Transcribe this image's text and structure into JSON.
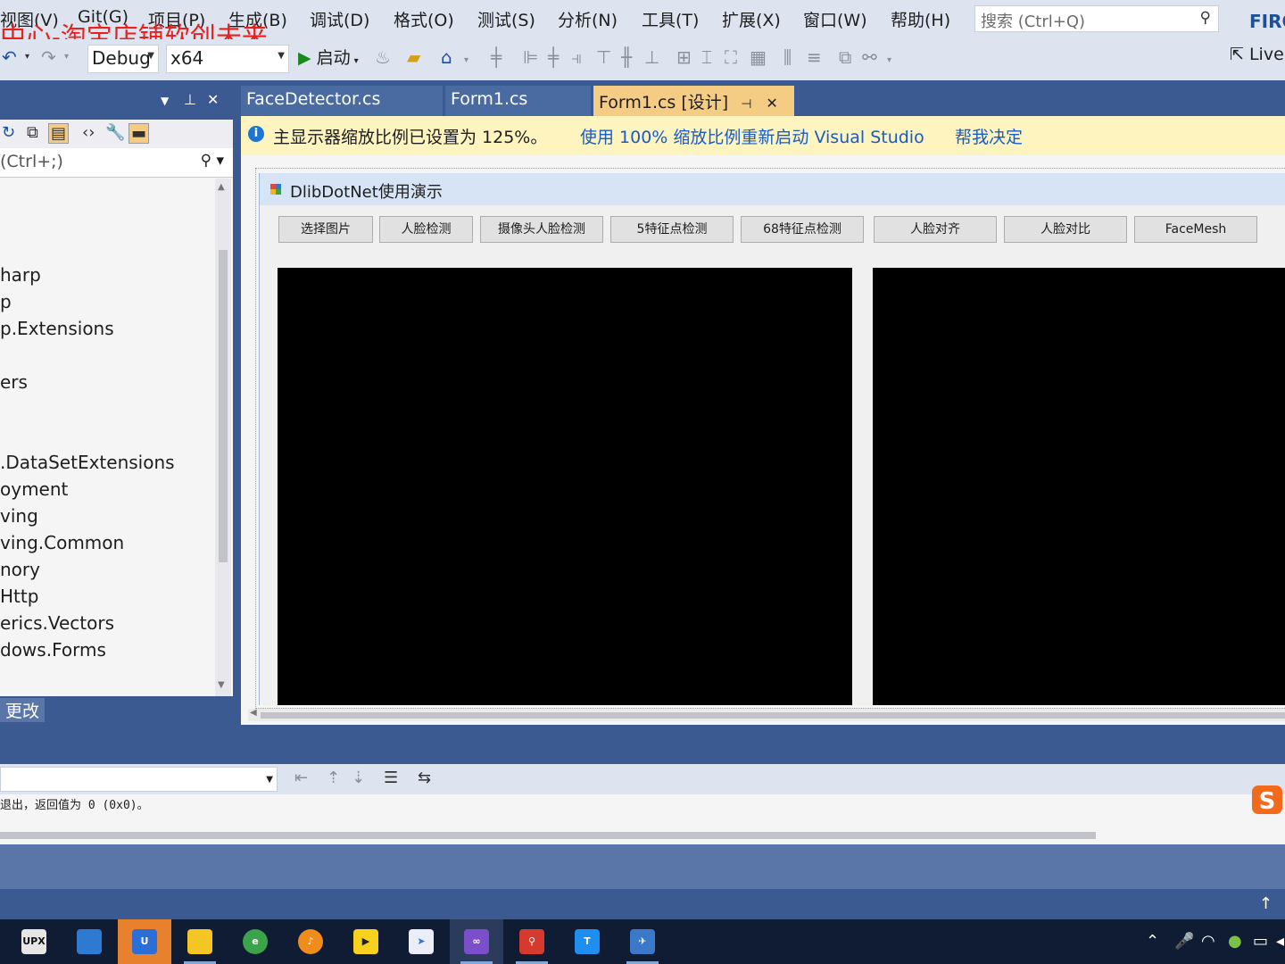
{
  "menu": {
    "items": [
      "视图(V)",
      "Git(G)",
      "项目(P)",
      "生成(B)",
      "调试(D)",
      "格式(O)",
      "测试(S)",
      "分析(N)",
      "工具(T)",
      "扩展(X)",
      "窗口(W)",
      "帮助(H)"
    ],
    "search_placeholder": "搜索 (Ctrl+Q)",
    "account_label": "FIRC"
  },
  "watermark": "中心-淘宝店铺软创未来",
  "toolbar": {
    "config": "Debug",
    "platform": "x64",
    "start_label": "启动",
    "live_share_label": "Live"
  },
  "solution_explorer": {
    "search_placeholder": "(Ctrl+;)",
    "tree_items": [
      "harp",
      "p",
      "p.Extensions",
      "ers",
      ".DataSetExtensions",
      "oyment",
      "ving",
      "ving.Common",
      "nory",
      "Http",
      "erics.Vectors",
      "dows.Forms"
    ],
    "changes_label": "更改"
  },
  "tabs": [
    {
      "label": "FaceDetector.cs"
    },
    {
      "label": "Form1.cs"
    },
    {
      "label": "Form1.cs [设计]"
    }
  ],
  "infobar": {
    "message": "主显示器缩放比例已设置为 125%。",
    "restart_link": "使用 100% 缩放比例重新启动 Visual Studio",
    "help_link": "帮我决定"
  },
  "form": {
    "title": "DlibDotNet使用演示",
    "buttons": [
      "选择图片",
      "人脸检测",
      "摄像头人脸检测",
      "5特征点检测",
      "68特征点检测",
      "人脸对齐",
      "人脸对比",
      "FaceMesh"
    ]
  },
  "output": {
    "text": "退出，返回值为 0 (0x0)。"
  },
  "taskbar": {
    "apps": [
      "UPX",
      "notes",
      "uTools",
      "explorer",
      "browser",
      "music",
      "player",
      "kite",
      "visual-studio",
      "search",
      "tencent-meeting",
      "tool"
    ]
  }
}
